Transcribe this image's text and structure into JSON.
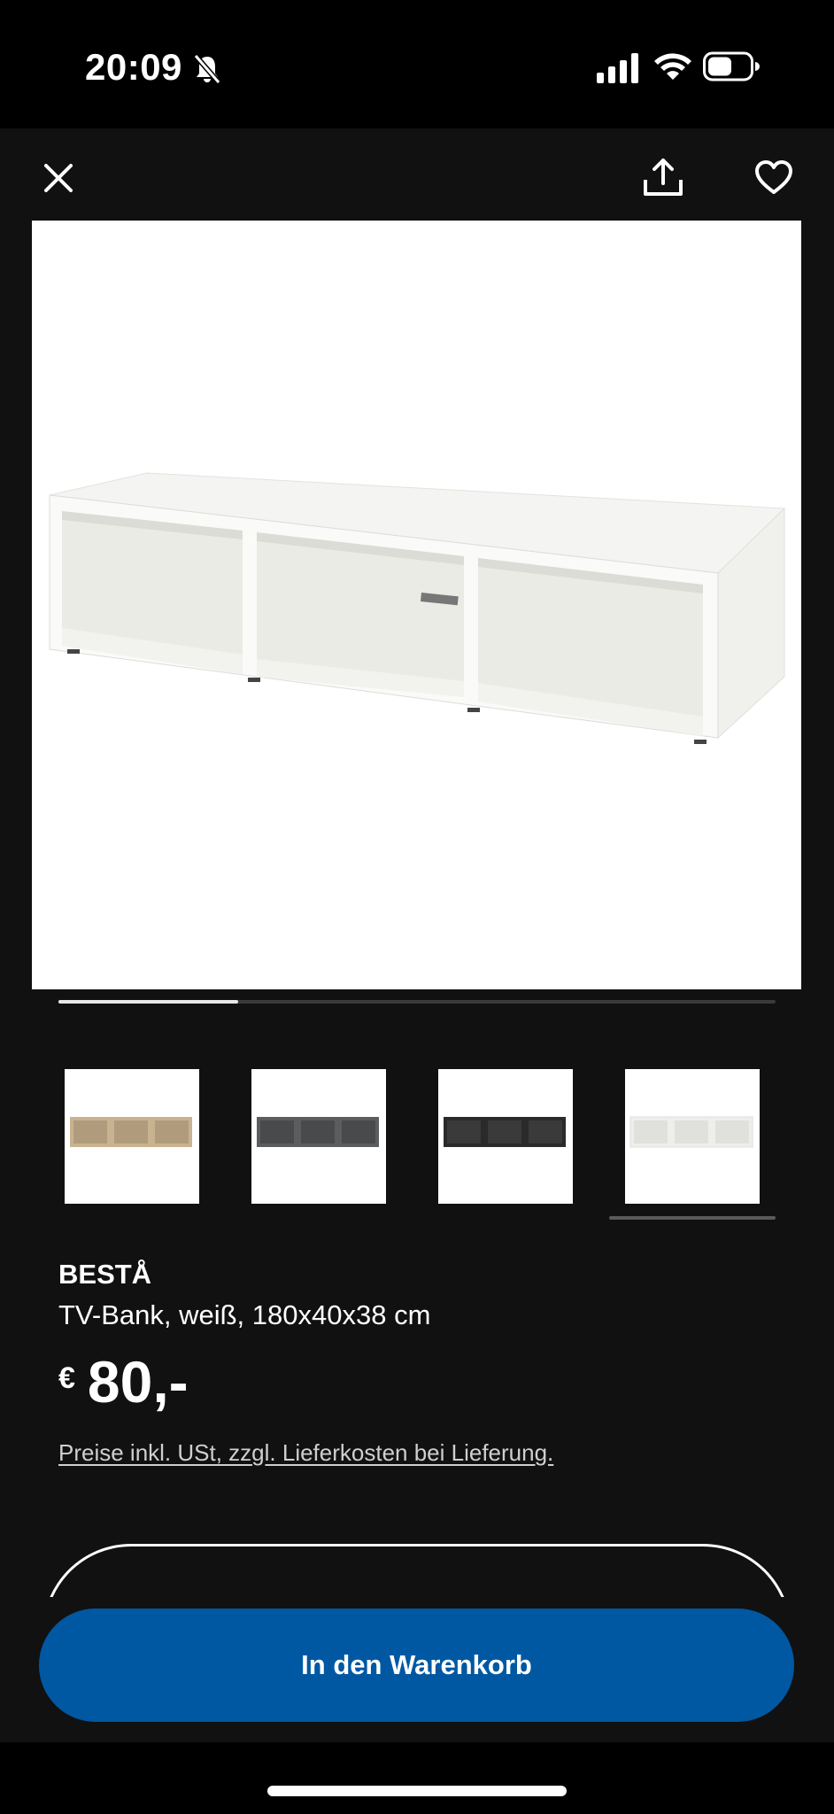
{
  "status_bar": {
    "time": "20:09",
    "icons": [
      "bell-slash-icon",
      "cellular-signal-icon",
      "wifi-icon",
      "battery-icon"
    ]
  },
  "top_bar": {
    "close_icon": "close-icon",
    "share_icon": "share-icon",
    "favorite_icon": "heart-icon"
  },
  "gallery": {
    "image_alt": "BESTÅ TV-Bank weiß",
    "progress": 0.25,
    "thumbnails": [
      {
        "variant": "white stained oak effect",
        "color": "#c9b28f",
        "selected": false
      },
      {
        "variant": "dark grey",
        "color": "#5b5d5f",
        "selected": false
      },
      {
        "variant": "black-brown",
        "color": "#2a2a2a",
        "selected": false
      },
      {
        "variant": "white",
        "color": "#eeeeea",
        "selected": true
      }
    ]
  },
  "product": {
    "name": "BESTÅ",
    "description": "TV-Bank, weiß, 180x40x38 cm",
    "currency": "€",
    "price": "80,-",
    "price_note": "Preise inkl. USt, zzgl. Lieferkosten bei Lieferung."
  },
  "actions": {
    "add_to_cart_label": "In den Warenkorb"
  },
  "colors": {
    "background": "#111111",
    "accent_blue": "#0058a3",
    "text": "#ffffff"
  }
}
